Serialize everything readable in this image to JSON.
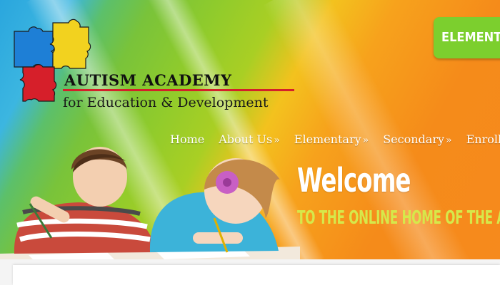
{
  "logo": {
    "title": "AUTISM ACADEMY",
    "subtitle": "for Education & Development",
    "puzzle_colors": [
      "#1e7fd6",
      "#f2d21f",
      "#d61f2a"
    ]
  },
  "header": {
    "button_label": "ELEMENTARY"
  },
  "nav": {
    "items": [
      {
        "label": "Home",
        "has_submenu": false
      },
      {
        "label": "About Us",
        "has_submenu": true
      },
      {
        "label": "Elementary",
        "has_submenu": true
      },
      {
        "label": "Secondary",
        "has_submenu": true
      },
      {
        "label": "Enrollment",
        "has_submenu": false
      }
    ],
    "submenu_arrow": "»"
  },
  "hero": {
    "heading": "Welcome",
    "tagline": "TO THE ONLINE HOME OF THE AUTISM ACADEMY",
    "photo": "children-writing-photo"
  },
  "colors": {
    "banner_start": "#2aa6de",
    "banner_mid": "#8fcb2c",
    "banner_end": "#f68a1d",
    "button": "#7ccf2e",
    "tagline": "#d6e84a",
    "logo_rule": "#d4202a"
  }
}
